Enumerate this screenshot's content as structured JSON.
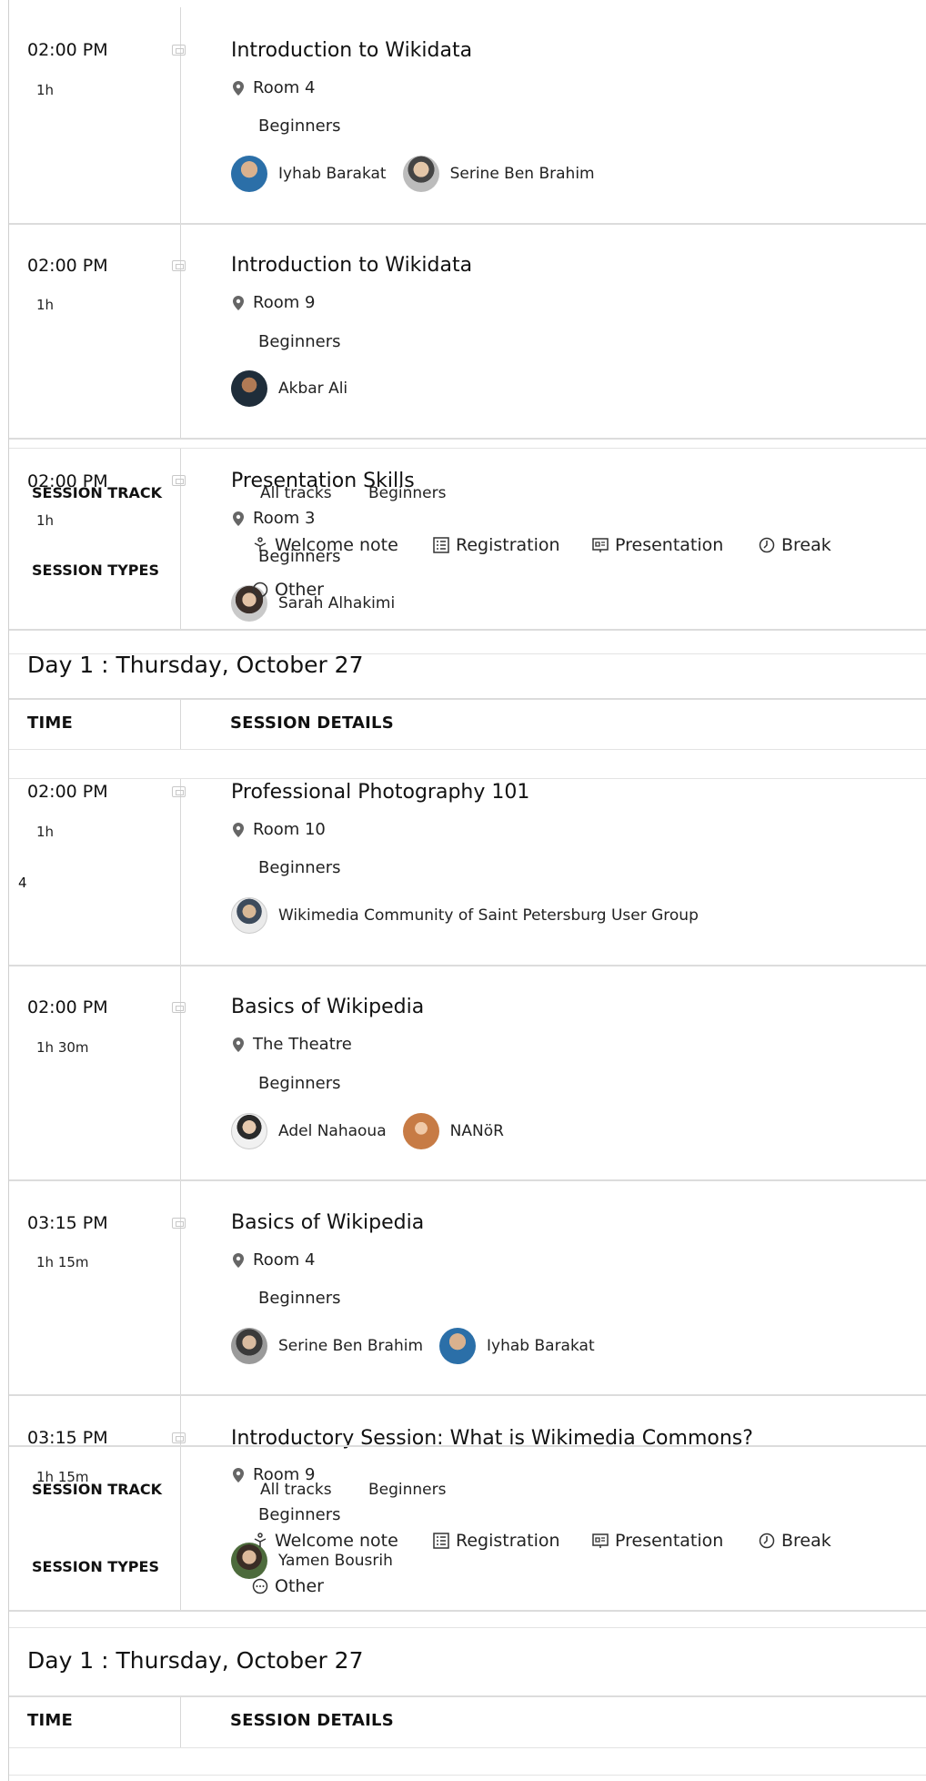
{
  "sessions_top": [
    {
      "time": "02:00 PM",
      "duration": "1h",
      "title": "Introduction to Wikidata",
      "room": "Room 4",
      "track": "Beginners",
      "speakers": [
        {
          "name": "Iyhab Barakat",
          "color": "#2b6fa8"
        },
        {
          "name": "Serine Ben Brahim",
          "color": "#8a8a8a"
        }
      ]
    },
    {
      "time": "02:00 PM",
      "duration": "1h",
      "title": "Introduction to Wikidata",
      "room": "Room 9",
      "track": "Beginners",
      "speakers": [
        {
          "name": "Akbar Ali",
          "color": "#2c3e50"
        }
      ]
    },
    {
      "time": "02:00 PM",
      "duration": "1h",
      "title": "Presentation Skills",
      "room": "Room 3",
      "track": "Beginners",
      "speakers": [
        {
          "name": "Sarah Alhakimi",
          "color": "#7d6a5c"
        }
      ]
    }
  ],
  "filters_1": {
    "session_track_label": "SESSION TRACK",
    "tracks": [
      "All tracks",
      "Beginners"
    ],
    "session_types_label": "SESSION TYPES",
    "types": [
      "Welcome note",
      "Registration",
      "Presentation",
      "Break",
      "Other"
    ]
  },
  "day_header_1": {
    "title": "Day 1 : Thursday, October 27",
    "time_col": "TIME",
    "details_col": "SESSION DETAILS"
  },
  "side_number": "4",
  "sessions_mid": [
    {
      "time": "02:00 PM",
      "duration": "1h",
      "title": "Professional Photography 101",
      "room": "Room 10",
      "track": "Beginners",
      "speakers": [
        {
          "name": "Wikimedia Community of Saint Petersburg User Group",
          "color": "#4a5a6a"
        }
      ]
    },
    {
      "time": "02:00 PM",
      "duration": "1h 30m",
      "title": "Basics of Wikipedia",
      "room": "The Theatre",
      "track": "Beginners",
      "speakers": [
        {
          "name": "Adel Nahaoua",
          "color": "#9a9a9a"
        },
        {
          "name": "NANöR",
          "color": "#c77b45"
        }
      ]
    },
    {
      "time": "03:15 PM",
      "duration": "1h 15m",
      "title": "Basics of Wikipedia",
      "room": "Room 4",
      "track": "Beginners",
      "speakers": [
        {
          "name": "Serine Ben Brahim",
          "color": "#555555"
        },
        {
          "name": "Iyhab Barakat",
          "color": "#2b6fa8"
        }
      ]
    },
    {
      "time": "03:15 PM",
      "duration": "1h 15m",
      "title": "Introductory Session: What is Wikimedia Commons?",
      "room": "Room 9",
      "track": "Beginners",
      "speakers": [
        {
          "name": "Yamen Bousrih",
          "color": "#4d6b3c"
        }
      ]
    }
  ],
  "filters_2": {
    "session_track_label": "SESSION TRACK",
    "tracks": [
      "All tracks",
      "Beginners"
    ],
    "session_types_label": "SESSION TYPES",
    "types": [
      "Welcome note",
      "Registration",
      "Presentation",
      "Break",
      "Other"
    ]
  },
  "day_header_2": {
    "title": "Day 1 : Thursday, October 27",
    "time_col": "TIME",
    "details_col": "SESSION DETAILS"
  }
}
